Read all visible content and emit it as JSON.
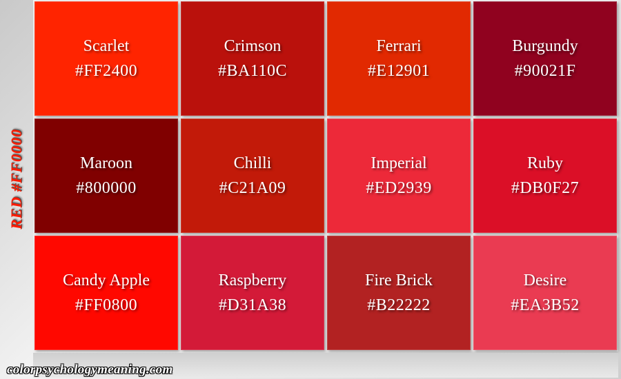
{
  "side_label": "RED #FF0000",
  "footer": "colorpsychologymeaning.com",
  "tiles": [
    {
      "name": "Scarlet",
      "hex": "#FF2400",
      "color": "#FF2400"
    },
    {
      "name": "Crimson",
      "hex": "#BA110C",
      "color": "#BA110C"
    },
    {
      "name": "Ferrari",
      "hex": "#E12901",
      "color": "#E12901"
    },
    {
      "name": "Burgundy",
      "hex": "#90021F",
      "color": "#90021F"
    },
    {
      "name": "Maroon",
      "hex": "#800000",
      "color": "#800000"
    },
    {
      "name": "Chilli",
      "hex": "#C21A09",
      "color": "#C21A09"
    },
    {
      "name": "Imperial",
      "hex": "#ED2939",
      "color": "#ED2939"
    },
    {
      "name": "Ruby",
      "hex": "#DB0F27",
      "color": "#DB0F27"
    },
    {
      "name": "Candy Apple",
      "hex": "#FF0800",
      "color": "#FF0800"
    },
    {
      "name": "Raspberry",
      "hex": "#D31A38",
      "color": "#D31A38"
    },
    {
      "name": "Fire Brick",
      "hex": "#B22222",
      "color": "#B22222"
    },
    {
      "name": "Desire",
      "hex": "#EA3B52",
      "color": "#EA3B52"
    }
  ]
}
